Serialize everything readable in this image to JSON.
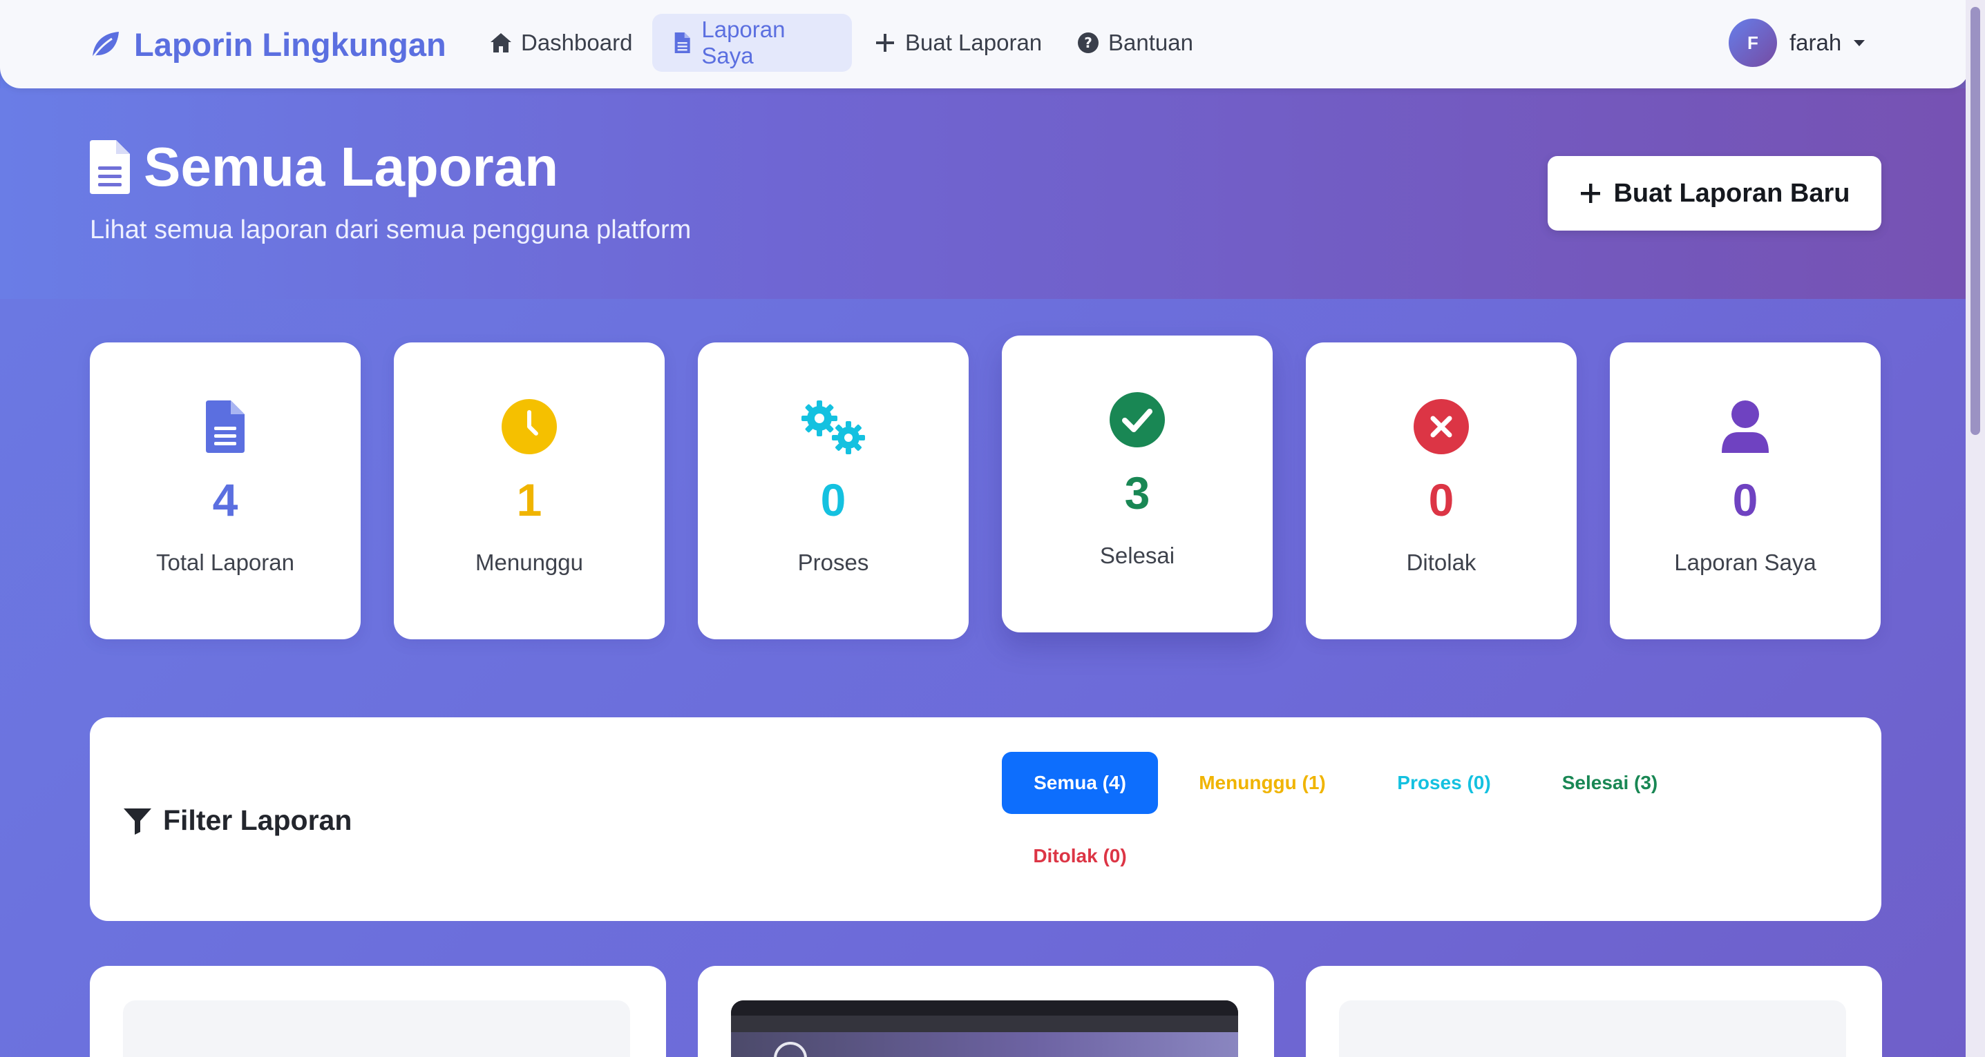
{
  "navbar": {
    "brand": "Laporin Lingkungan",
    "items": [
      {
        "label": "Dashboard",
        "icon": "home-icon"
      },
      {
        "label": "Laporan Saya",
        "icon": "file-icon",
        "active": true
      },
      {
        "label": "Buat Laporan",
        "icon": "plus-icon"
      },
      {
        "label": "Bantuan",
        "icon": "question-circle-icon"
      }
    ],
    "user": {
      "initial": "F",
      "name": "farah"
    }
  },
  "hero": {
    "title": "Semua Laporan",
    "subtitle": "Lihat semua laporan dari semua pengguna platform",
    "new_button": "Buat Laporan Baru"
  },
  "stats": [
    {
      "value": "4",
      "label": "Total Laporan",
      "color": "#5b6fe0",
      "icon": "file-icon"
    },
    {
      "value": "1",
      "label": "Menunggu",
      "color": "#f0b400",
      "icon": "clock-icon"
    },
    {
      "value": "0",
      "label": "Proses",
      "color": "#14c1e0",
      "icon": "gears-icon"
    },
    {
      "value": "3",
      "label": "Selesai",
      "color": "#198754",
      "icon": "check-circle-icon"
    },
    {
      "value": "0",
      "label": "Ditolak",
      "color": "#dc3545",
      "icon": "x-circle-icon"
    },
    {
      "value": "0",
      "label": "Laporan Saya",
      "color": "#6f42c1",
      "icon": "user-icon"
    }
  ],
  "filter": {
    "title": "Filter Laporan",
    "buttons": [
      {
        "label": "Semua (4)",
        "color": "#ffffff",
        "bg": "#0d6efd",
        "active": true
      },
      {
        "label": "Menunggu (1)",
        "color": "#f0b400"
      },
      {
        "label": "Proses (0)",
        "color": "#14c1e0"
      },
      {
        "label": "Selesai (3)",
        "color": "#198754"
      },
      {
        "label": "Ditolak (0)",
        "color": "#dc3545"
      }
    ]
  },
  "colors": {
    "accent": "#5b6fe0",
    "gradient_start": "#667eea",
    "gradient_end": "#764ba2"
  }
}
